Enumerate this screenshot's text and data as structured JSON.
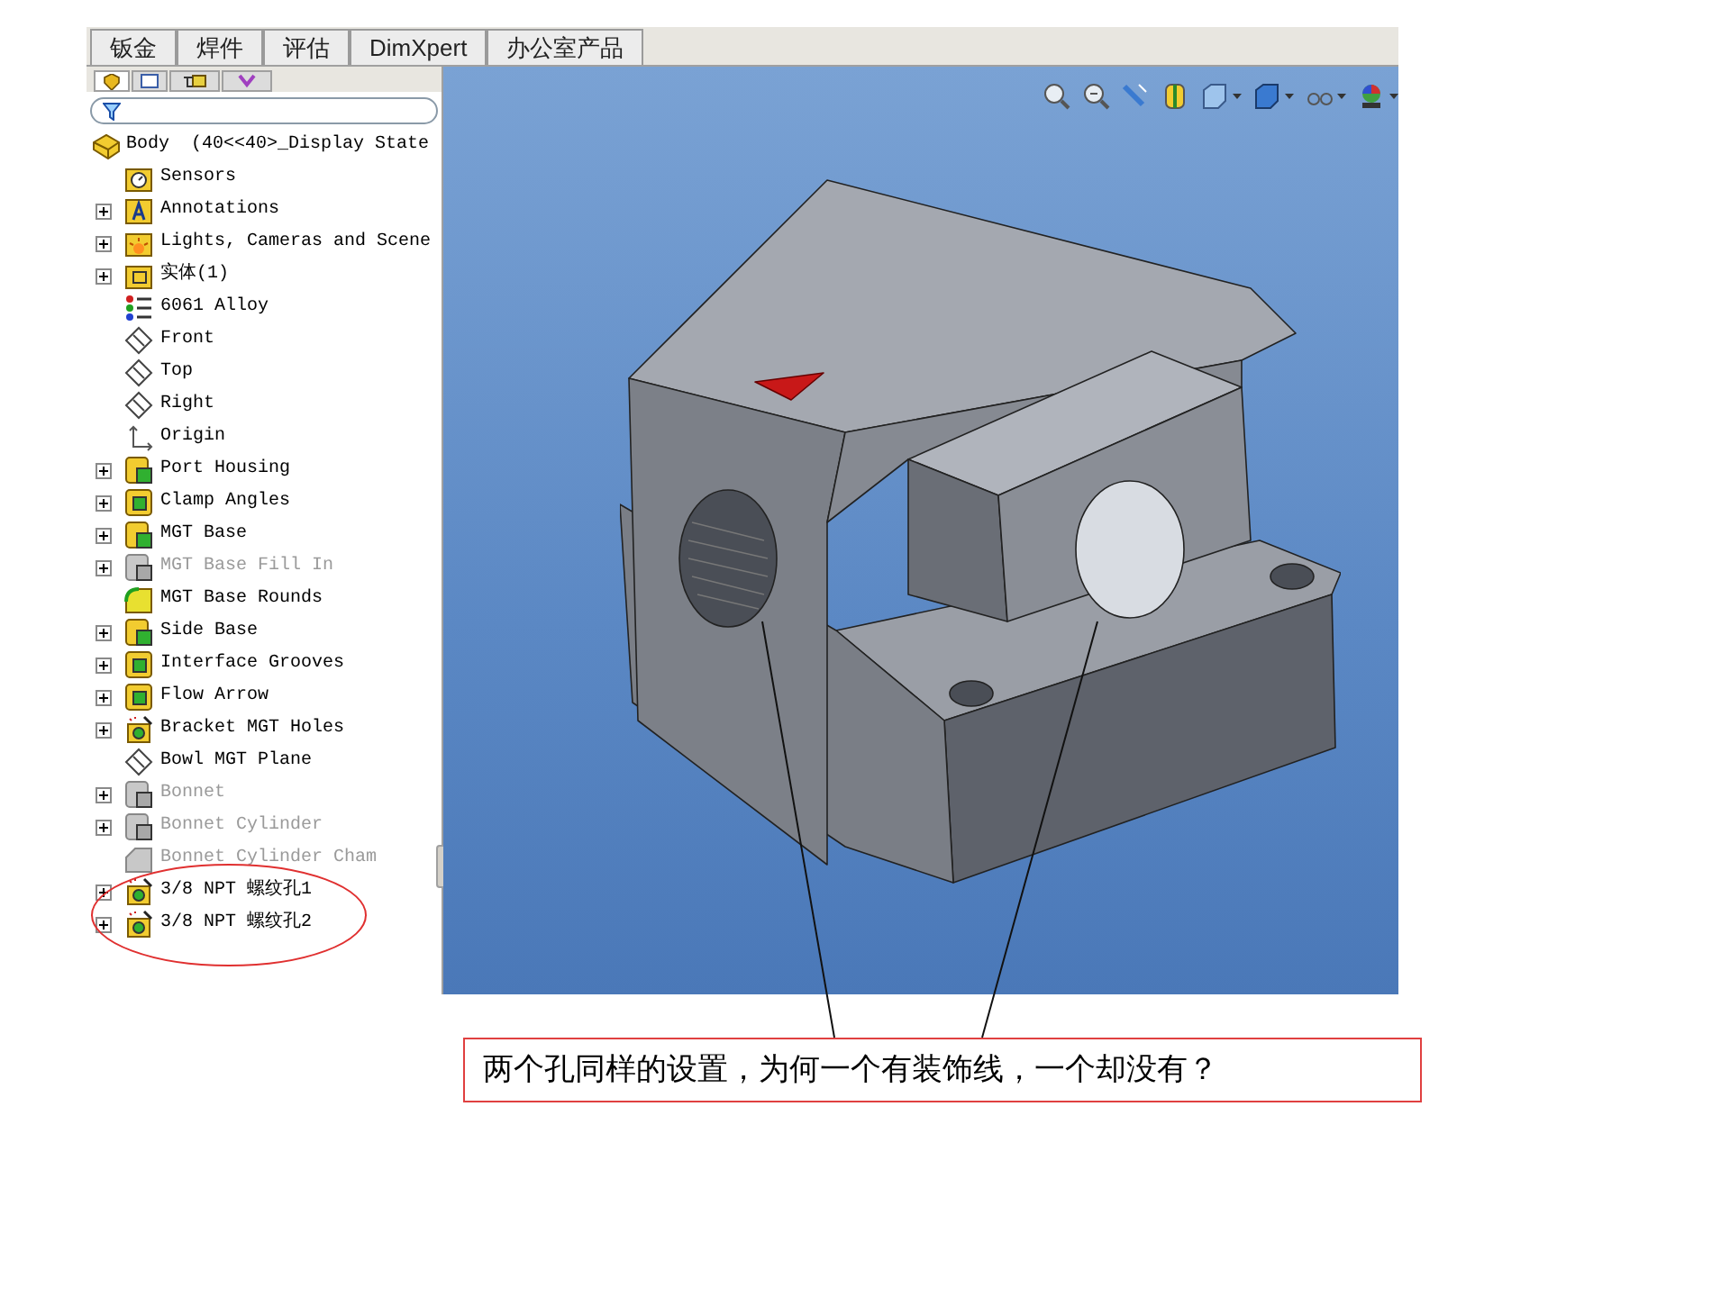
{
  "command_tabs": [
    {
      "label": "钣金"
    },
    {
      "label": "焊件"
    },
    {
      "label": "评估"
    },
    {
      "label": "DimXpert"
    },
    {
      "label": "办公室产品"
    }
  ],
  "feature_tree": {
    "root": {
      "label": "Body  (40<<40>_Display State",
      "kind": "part"
    },
    "items": [
      {
        "label": "Sensors",
        "kind": "sensors",
        "expandable": false,
        "suppressed": false
      },
      {
        "label": "Annotations",
        "kind": "annotations",
        "expandable": true,
        "suppressed": false
      },
      {
        "label": "Lights, Cameras and Scene",
        "kind": "lights",
        "expandable": true,
        "suppressed": false
      },
      {
        "label": "实体(1)",
        "kind": "solid-bodies",
        "expandable": true,
        "suppressed": false
      },
      {
        "label": "6061 Alloy",
        "kind": "material",
        "expandable": false,
        "suppressed": false
      },
      {
        "label": "Front",
        "kind": "plane",
        "expandable": false,
        "suppressed": false
      },
      {
        "label": "Top",
        "kind": "plane",
        "expandable": false,
        "suppressed": false
      },
      {
        "label": "Right",
        "kind": "plane",
        "expandable": false,
        "suppressed": false
      },
      {
        "label": "Origin",
        "kind": "origin",
        "expandable": false,
        "suppressed": false
      },
      {
        "label": "Port Housing",
        "kind": "boss",
        "expandable": true,
        "suppressed": false
      },
      {
        "label": "Clamp Angles",
        "kind": "cut",
        "expandable": true,
        "suppressed": false
      },
      {
        "label": "MGT Base",
        "kind": "boss",
        "expandable": true,
        "suppressed": false
      },
      {
        "label": "MGT Base Fill In",
        "kind": "boss",
        "expandable": true,
        "suppressed": true
      },
      {
        "label": "MGT Base Rounds",
        "kind": "fillet",
        "expandable": false,
        "suppressed": false
      },
      {
        "label": "Side Base",
        "kind": "boss",
        "expandable": true,
        "suppressed": false
      },
      {
        "label": "Interface Grooves",
        "kind": "cut",
        "expandable": true,
        "suppressed": false
      },
      {
        "label": "Flow Arrow",
        "kind": "cut",
        "expandable": true,
        "suppressed": false
      },
      {
        "label": "Bracket MGT Holes",
        "kind": "hole",
        "expandable": true,
        "suppressed": false
      },
      {
        "label": "Bowl MGT Plane",
        "kind": "plane",
        "expandable": false,
        "suppressed": false
      },
      {
        "label": "Bonnet",
        "kind": "boss",
        "expandable": true,
        "suppressed": true
      },
      {
        "label": "Bonnet Cylinder",
        "kind": "boss",
        "expandable": true,
        "suppressed": true
      },
      {
        "label": "Bonnet Cylinder Cham",
        "kind": "chamfer",
        "expandable": false,
        "suppressed": true
      },
      {
        "label": "3/8 NPT 螺纹孔1",
        "kind": "hole",
        "expandable": true,
        "suppressed": false
      },
      {
        "label": "3/8 NPT 螺纹孔2",
        "kind": "hole",
        "expandable": true,
        "suppressed": false
      }
    ]
  },
  "callout": {
    "text": "两个孔同样的设置，为何一个有装饰线，一个却没有？"
  }
}
